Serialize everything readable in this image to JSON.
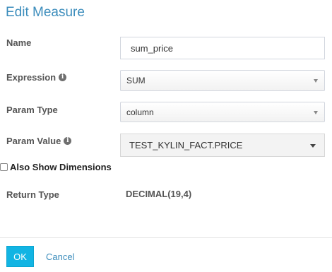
{
  "dialog": {
    "title": "Edit Measure"
  },
  "form": {
    "name": {
      "label": "Name",
      "value": "sum_price"
    },
    "expression": {
      "label": "Expression",
      "selected": "SUM",
      "icon": "info-circle-icon"
    },
    "param_type": {
      "label": "Param Type",
      "selected": "column"
    },
    "param_value": {
      "label": "Param Value",
      "selected": "TEST_KYLIN_FACT.PRICE",
      "icon": "info-circle-icon"
    },
    "also_show_dimensions": {
      "label": "Also Show Dimensions",
      "checked": false
    },
    "return_type": {
      "label": "Return Type",
      "value": "DECIMAL(19,4)"
    }
  },
  "footer": {
    "ok_label": "OK",
    "cancel_label": "Cancel"
  },
  "colors": {
    "accent": "#3c8dbc",
    "primary_button": "#12b4e3"
  }
}
